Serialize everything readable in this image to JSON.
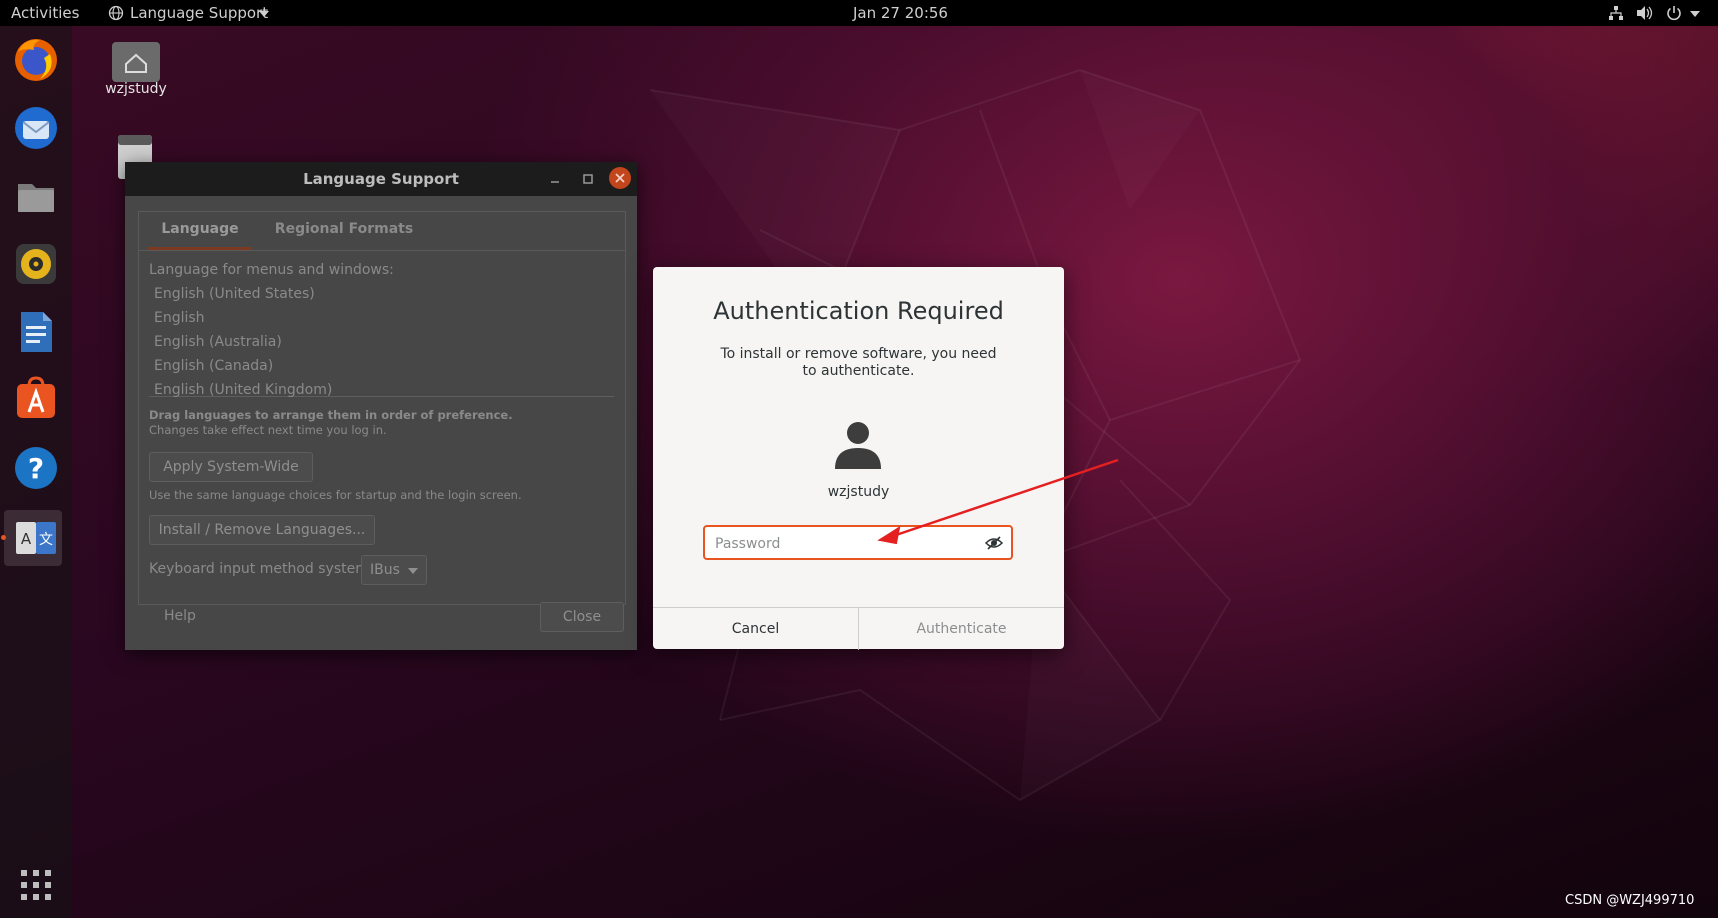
{
  "topbar": {
    "activities": "Activities",
    "app_menu": "Language Support",
    "clock": "Jan 27  20:56"
  },
  "desktop": {
    "home_label": "wzjstudy"
  },
  "language_window": {
    "title": "Language Support",
    "tabs": [
      {
        "label": "Language"
      },
      {
        "label": "Regional Formats"
      }
    ],
    "menus_label": "Language for menus and windows:",
    "languages": [
      "English (United States)",
      "English",
      "English (Australia)",
      "English (Canada)",
      "English (United Kingdom)"
    ],
    "drag_hint_bold": "Drag languages to arrange them in order of preference.",
    "drag_hint": "Changes take effect next time you log in.",
    "apply_button": "Apply System-Wide",
    "apply_hint": "Use the same language choices for startup and the login screen.",
    "install_button": "Install / Remove Languages...",
    "keyboard_label": "Keyboard input method system:",
    "keyboard_value": "IBus",
    "help_button": "Help",
    "close_button": "Close"
  },
  "auth_dialog": {
    "title": "Authentication Required",
    "message": "To install or remove software, you need to authenticate.",
    "username": "wzjstudy",
    "password_placeholder": "Password",
    "password_value": "",
    "cancel_label": "Cancel",
    "authenticate_label": "Authenticate",
    "accent_color": "#e95420"
  },
  "watermark": "CSDN @WZJ499710"
}
